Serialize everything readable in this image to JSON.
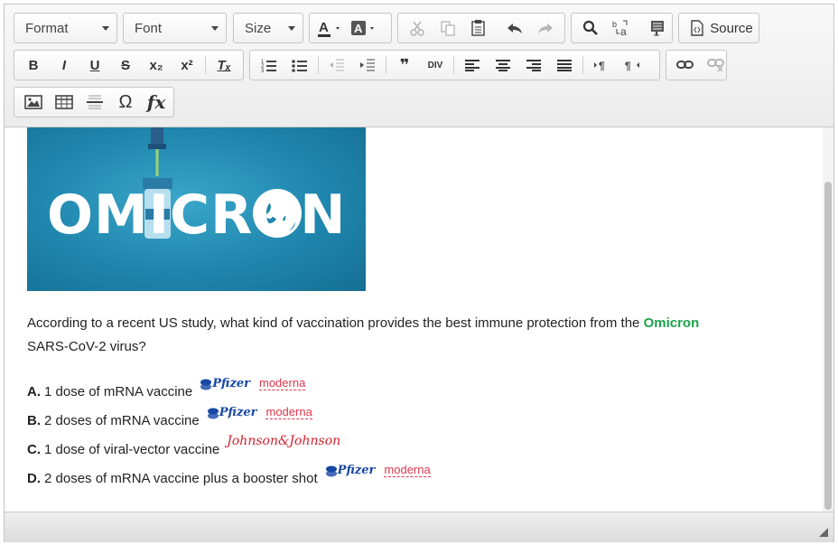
{
  "toolbar": {
    "format_label": "Format",
    "font_label": "Font",
    "size_label": "Size",
    "source_label": "Source",
    "bold": "B",
    "italic": "I",
    "underline": "U",
    "strike": "S",
    "subscript": "x₂",
    "superscript": "x²",
    "remove_format": "Tₓ",
    "blockquote": "❞",
    "div": "DIV",
    "special_char": "Ω",
    "formula": "fx"
  },
  "content": {
    "banner_text": "OMICRON",
    "question_part1": "According to a recent US study, what kind of vaccination provides the best immune protection from the ",
    "question_highlight": "Omicron",
    "question_part2": " SARS-CoV-2 virus?",
    "answers": [
      {
        "letter": "A.",
        "text": "1 dose of mRNA vaccine",
        "logos": [
          "Pfizer",
          "moderna"
        ]
      },
      {
        "letter": "B.",
        "text": "2 doses of mRNA vaccine",
        "logos": [
          "Pfizer",
          "moderna"
        ]
      },
      {
        "letter": "C.",
        "text": "1 dose of viral-vector vaccine",
        "logos": [
          "Johnson&Johnson"
        ]
      },
      {
        "letter": "D.",
        "text": "2 doses of mRNA vaccine plus a booster shot",
        "logos": [
          "Pfizer",
          "moderna"
        ]
      }
    ]
  },
  "colors": {
    "highlight": "#1aa34a",
    "pfizer": "#1747a6",
    "moderna": "#e0364a",
    "banner": "#1f86ad"
  }
}
